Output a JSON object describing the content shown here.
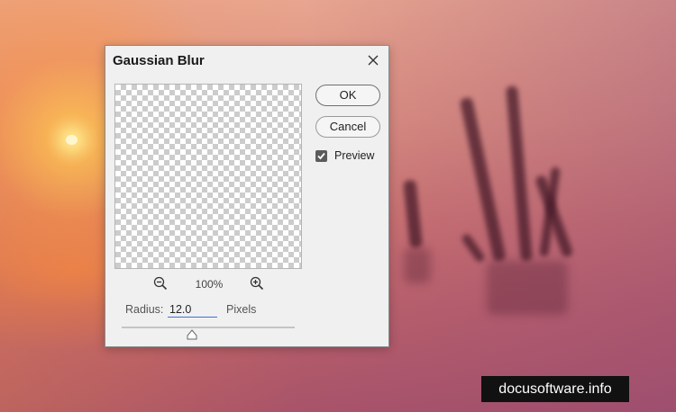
{
  "dialog": {
    "title": "Gaussian Blur",
    "ok_label": "OK",
    "cancel_label": "Cancel",
    "preview_label": "Preview",
    "preview_checked": true,
    "zoom_level": "100%",
    "radius_label": "Radius:",
    "radius_value": "12.0",
    "radius_unit": "Pixels"
  },
  "watermark": {
    "text": "docusoftware.info"
  },
  "icons": {
    "close": "close-icon",
    "zoom_out": "zoom-out-icon",
    "zoom_in": "zoom-in-icon",
    "checkmark": "checkmark-icon",
    "slider_thumb": "slider-thumb-icon"
  },
  "colors": {
    "input_underline": "#3b74d6",
    "checkbox_fill": "#5b5b5b",
    "dialog_bg": "#f0f0f0"
  }
}
